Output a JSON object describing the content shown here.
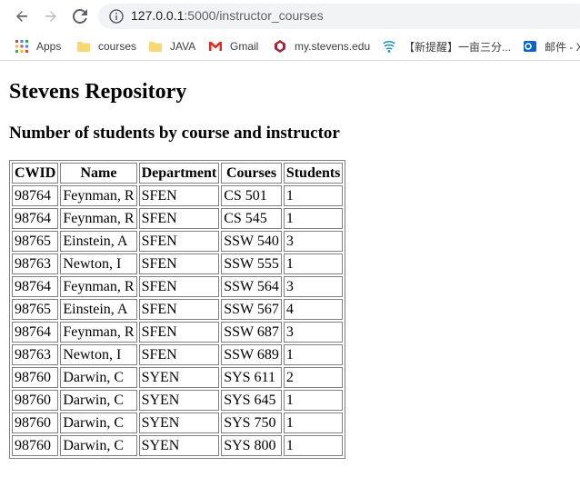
{
  "browser": {
    "url_host": "127.0.0.1",
    "url_path": ":5000/instructor_courses",
    "bookmarks": [
      {
        "label": "Apps",
        "icon": "apps-grid-icon"
      },
      {
        "label": "courses",
        "icon": "folder-icon"
      },
      {
        "label": "JAVA",
        "icon": "folder-icon"
      },
      {
        "label": "Gmail",
        "icon": "gmail-icon"
      },
      {
        "label": "my.stevens.edu",
        "icon": "stevens-icon"
      },
      {
        "label": "【新提醒】一亩三分...",
        "icon": "site-icon"
      },
      {
        "label": "邮件 - X",
        "icon": "outlook-icon"
      }
    ]
  },
  "page": {
    "title": "Stevens Repository",
    "subtitle": "Number of students by course and instructor"
  },
  "table": {
    "headers": [
      "CWID",
      "Name",
      "Department",
      "Courses",
      "Students"
    ],
    "rows": [
      [
        "98764",
        "Feynman, R",
        "SFEN",
        "CS 501",
        "1"
      ],
      [
        "98764",
        "Feynman, R",
        "SFEN",
        "CS 545",
        "1"
      ],
      [
        "98765",
        "Einstein, A",
        "SFEN",
        "SSW 540",
        "3"
      ],
      [
        "98763",
        "Newton, I",
        "SFEN",
        "SSW 555",
        "1"
      ],
      [
        "98764",
        "Feynman, R",
        "SFEN",
        "SSW 564",
        "3"
      ],
      [
        "98765",
        "Einstein, A",
        "SFEN",
        "SSW 567",
        "4"
      ],
      [
        "98764",
        "Feynman, R",
        "SFEN",
        "SSW 687",
        "3"
      ],
      [
        "98763",
        "Newton, I",
        "SFEN",
        "SSW 689",
        "1"
      ],
      [
        "98760",
        "Darwin, C",
        "SYEN",
        "SYS 611",
        "2"
      ],
      [
        "98760",
        "Darwin, C",
        "SYEN",
        "SYS 645",
        "1"
      ],
      [
        "98760",
        "Darwin, C",
        "SYEN",
        "SYS 750",
        "1"
      ],
      [
        "98760",
        "Darwin, C",
        "SYEN",
        "SYS 800",
        "1"
      ]
    ]
  }
}
